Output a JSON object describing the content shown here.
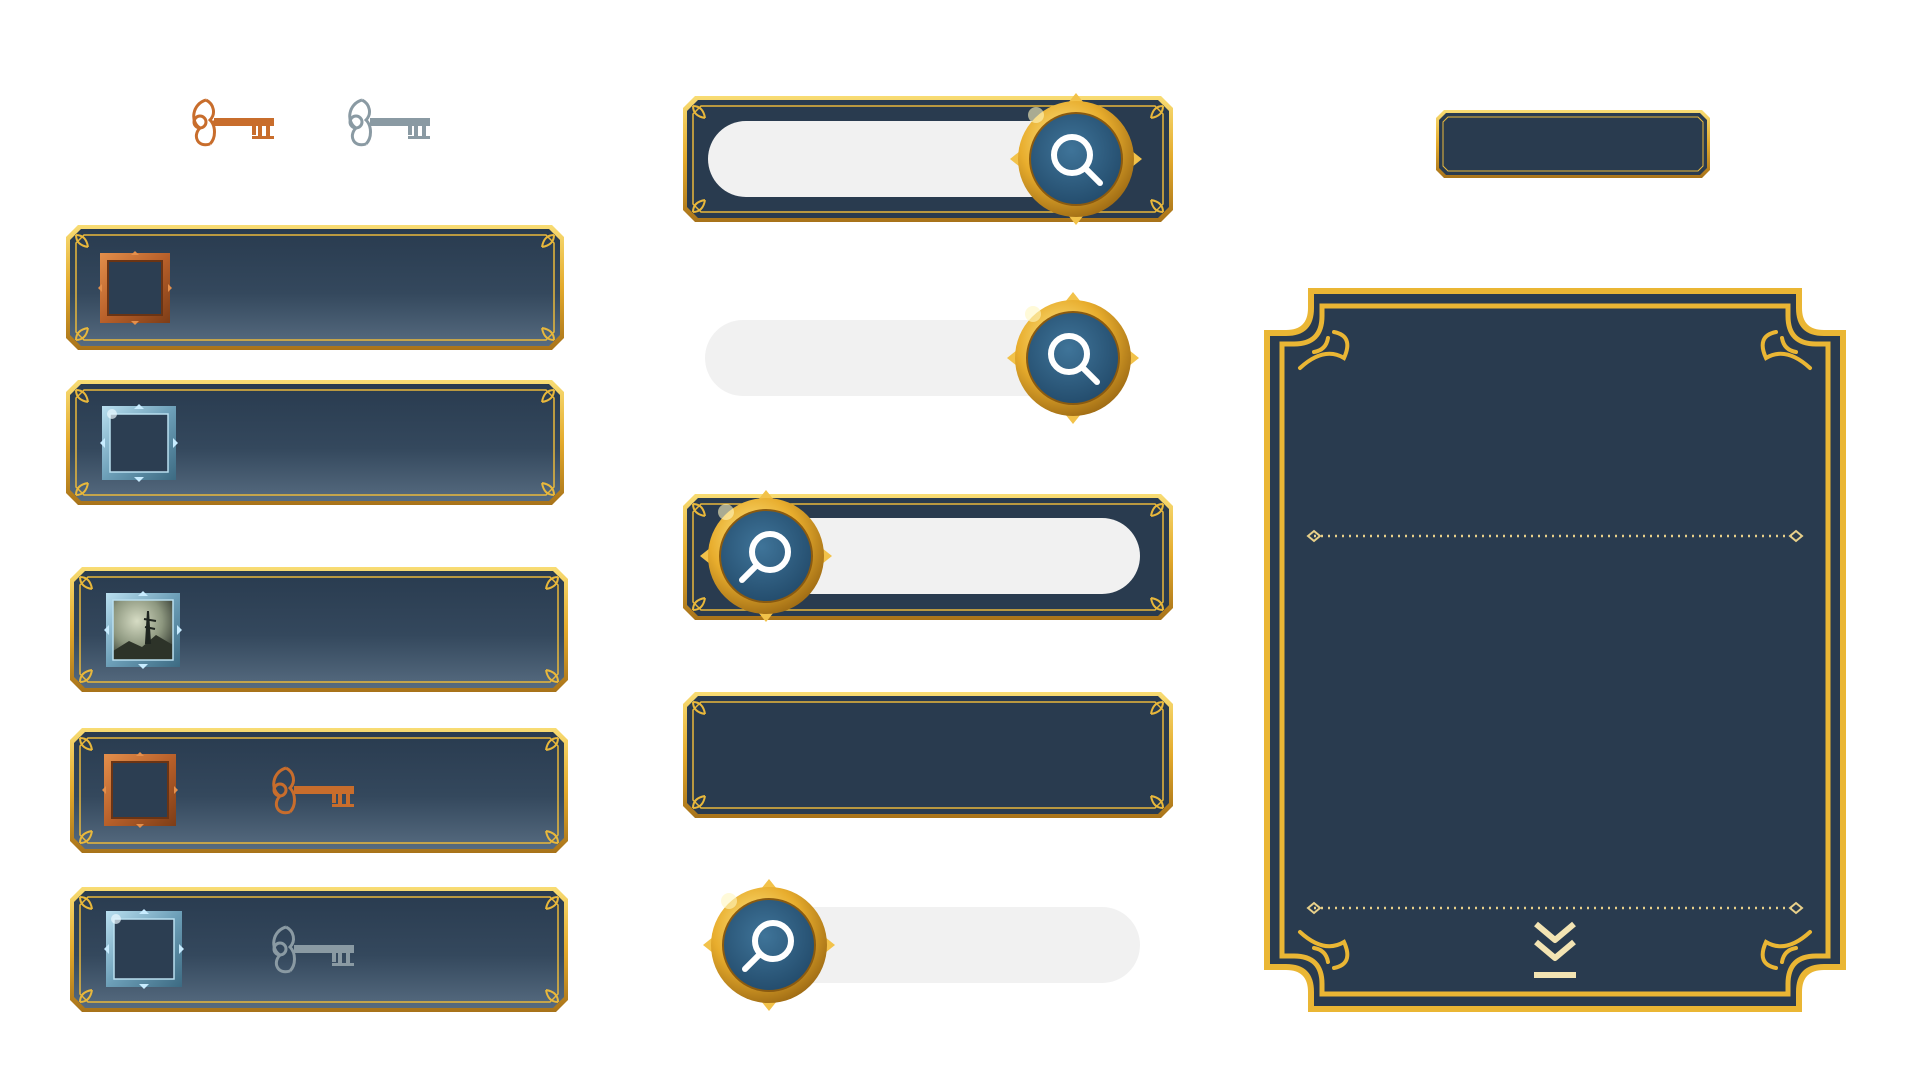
{
  "colors": {
    "panel_dark": "#293b4f",
    "panel_light": "#53687d",
    "gold": "#e9b83b",
    "gold_light": "#f6d66b",
    "gold_dark": "#a4741a",
    "search_field": "#f1f1f1",
    "button_blue": "#2f5e82",
    "copper": "#c86d2c",
    "silver": "#8fa3ad",
    "frame_blue": "#7fb0c8"
  },
  "keys": [
    {
      "icon": "copper-key-icon",
      "color": "#c86d2c"
    },
    {
      "icon": "silver-key-icon",
      "color": "#8a9aa3"
    }
  ],
  "list_panels": [
    {
      "frame": "copper",
      "thumbnail": "empty",
      "key": "none",
      "label": ""
    },
    {
      "frame": "ice",
      "thumbnail": "empty",
      "key": "none",
      "label": ""
    },
    {
      "frame": "ice",
      "thumbnail": "landscape-image",
      "key": "none",
      "label": ""
    },
    {
      "frame": "copper",
      "thumbnail": "empty",
      "key": "copper",
      "label": ""
    },
    {
      "frame": "ice",
      "thumbnail": "empty",
      "key": "silver",
      "label": ""
    }
  ],
  "search_bars": [
    {
      "style": "framed",
      "button_side": "right",
      "value": "",
      "placeholder": ""
    },
    {
      "style": "plain",
      "button_side": "right",
      "value": "",
      "placeholder": ""
    },
    {
      "style": "framed",
      "button_side": "left",
      "value": "",
      "placeholder": ""
    },
    {
      "style": "framed-empty",
      "button_side": "none",
      "value": "",
      "placeholder": ""
    },
    {
      "style": "plain",
      "button_side": "left",
      "value": "",
      "placeholder": ""
    }
  ],
  "title_banner": {
    "text": ""
  },
  "dialog": {
    "title": "",
    "body": "",
    "footer_icon": "double-chevron-down-icon"
  }
}
